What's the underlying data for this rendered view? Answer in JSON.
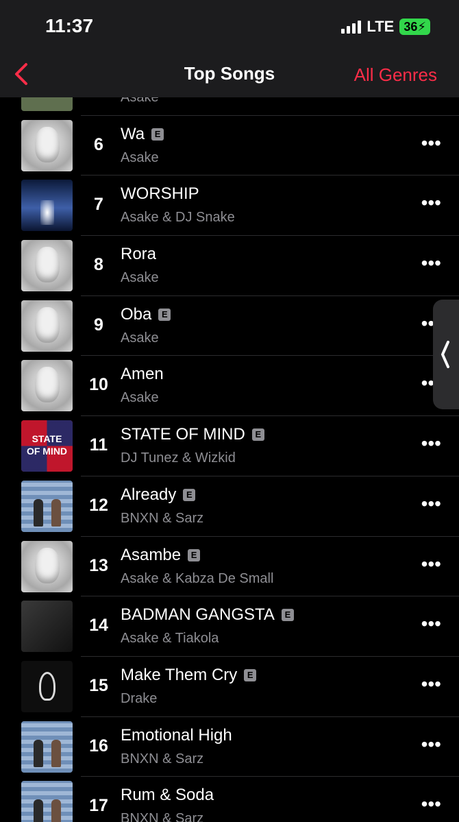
{
  "status": {
    "time": "11:37",
    "network": "LTE",
    "battery": "36"
  },
  "nav": {
    "title": "Top Songs",
    "genres": "All Genres"
  },
  "songs": [
    {
      "rank": "",
      "title": "",
      "artist": "Asake",
      "explicit": false,
      "art": "green"
    },
    {
      "rank": "6",
      "title": "Wa",
      "artist": "Asake",
      "explicit": true,
      "art": "face"
    },
    {
      "rank": "7",
      "title": "WORSHIP",
      "artist": "Asake & DJ Snake",
      "explicit": false,
      "art": "worship"
    },
    {
      "rank": "8",
      "title": "Rora",
      "artist": "Asake",
      "explicit": false,
      "art": "face"
    },
    {
      "rank": "9",
      "title": "Oba",
      "artist": "Asake",
      "explicit": true,
      "art": "face"
    },
    {
      "rank": "10",
      "title": "Amen",
      "artist": "Asake",
      "explicit": false,
      "art": "face"
    },
    {
      "rank": "11",
      "title": "STATE OF MIND",
      "artist": "DJ Tunez & Wizkid",
      "explicit": true,
      "art": "state"
    },
    {
      "rank": "12",
      "title": "Already",
      "artist": "BNXN & Sarz",
      "explicit": true,
      "art": "stadium"
    },
    {
      "rank": "13",
      "title": "Asambe",
      "artist": "Asake & Kabza De Small",
      "explicit": true,
      "art": "face"
    },
    {
      "rank": "14",
      "title": "BADMAN GANGSTA",
      "artist": "Asake & Tiakola",
      "explicit": true,
      "art": "dark"
    },
    {
      "rank": "15",
      "title": "Make Them Cry",
      "artist": "Drake",
      "explicit": true,
      "art": "hand"
    },
    {
      "rank": "16",
      "title": "Emotional High",
      "artist": "BNXN & Sarz",
      "explicit": false,
      "art": "stadium"
    },
    {
      "rank": "17",
      "title": "Rum & Soda",
      "artist": "BNXN & Sarz",
      "explicit": false,
      "art": "stadium"
    }
  ],
  "labels": {
    "explicit": "E",
    "more": "•••",
    "state_art": "STATE OF MIND"
  }
}
